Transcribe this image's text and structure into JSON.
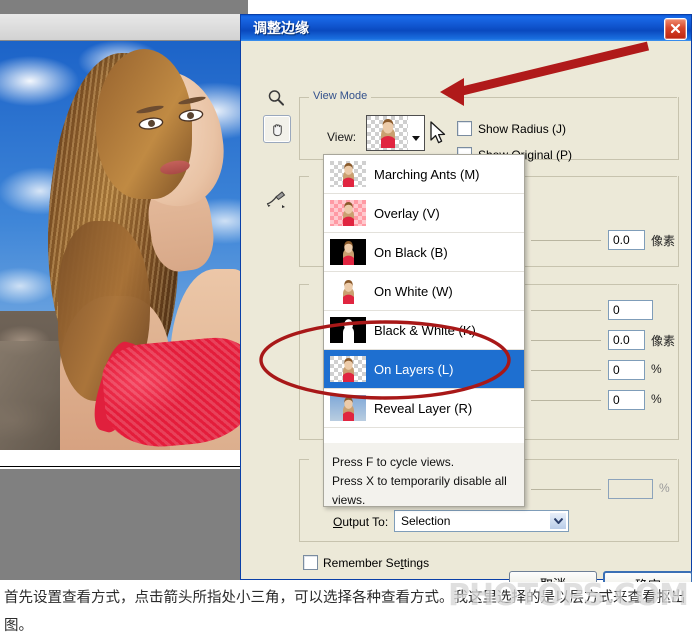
{
  "dialog": {
    "title": "调整边缘",
    "close_icon": "close-icon"
  },
  "tools": [
    {
      "name": "zoom-tool",
      "icon": "magnifier-icon"
    },
    {
      "name": "hand-tool",
      "icon": "hand-icon",
      "selected": true
    },
    {
      "name": "refine-radius-tool",
      "icon": "brush-icon"
    }
  ],
  "view_mode": {
    "group_title": "View Mode",
    "view_label": "View:",
    "show_radius_label": "Show Radius (J)",
    "show_original_label": "Show Original (P)",
    "show_radius_checked": false,
    "show_original_checked": false
  },
  "dropdown": {
    "items": [
      {
        "label": "Marching Ants (M)",
        "thumb": "checker",
        "selected": false
      },
      {
        "label": "Overlay (V)",
        "thumb": "overlay",
        "selected": false
      },
      {
        "label": "On Black (B)",
        "thumb": "black",
        "selected": false
      },
      {
        "label": "On White (W)",
        "thumb": "white",
        "selected": false
      },
      {
        "label": "Black & White (K)",
        "thumb": "bw",
        "selected": false
      },
      {
        "label": "On Layers (L)",
        "thumb": "checker",
        "selected": true
      },
      {
        "label": "Reveal Layer (R)",
        "thumb": "reveal",
        "selected": false
      }
    ],
    "hint_line_1": "Press F to cycle views.",
    "hint_line_2": "Press X to temporarily disable all views."
  },
  "fields": [
    {
      "name": "radius-field",
      "value": "0.0",
      "unit": "像素"
    },
    {
      "name": "smooth-field",
      "value": "0",
      "unit": ""
    },
    {
      "name": "feather-field",
      "value": "0.0",
      "unit": "像素"
    },
    {
      "name": "contrast-field",
      "value": "0",
      "unit": "%"
    },
    {
      "name": "shift-edge-field",
      "value": "0",
      "unit": "%"
    },
    {
      "name": "decontaminate-field",
      "value": "",
      "unit": "%"
    }
  ],
  "output": {
    "label_prefix": "",
    "label": "Output To:",
    "label_accel": "O",
    "label_rest": "utput To:",
    "selected": "Selection"
  },
  "remember": {
    "label_a": "Remember Se",
    "label_accel": "t",
    "label_b": "tings",
    "full_label": "Remember Settings",
    "checked": false
  },
  "buttons": {
    "cancel": "取消",
    "ok": "确定"
  },
  "caption": {
    "text": "首先设置查看方式，点击箭头所指处小三角，可以选择各种查看方式。我这里选择的是以层方式来查看抠出图。"
  },
  "watermark": {
    "text": "PHOTOPS.COM"
  },
  "annotations": {
    "arrow_color": "#b01a1a",
    "ellipse_color": "#a81818",
    "arrow_target": "view-dropdown-arrow",
    "ellipse_target": "dropdown-item-on-layers"
  },
  "colors": {
    "titlebar_blue": "#0a49be",
    "dialog_face": "#ece9d8",
    "selection_blue": "#1e6fd0",
    "group_label": "#33518c"
  }
}
